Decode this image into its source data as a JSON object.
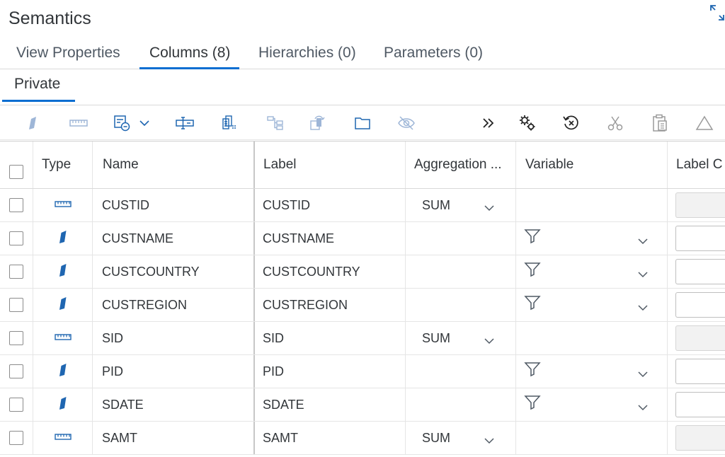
{
  "panel": {
    "title": "Semantics"
  },
  "tabs": [
    {
      "label": "View Properties"
    },
    {
      "label": "Columns (8)"
    },
    {
      "label": "Hierarchies (0)"
    },
    {
      "label": "Parameters (0)"
    }
  ],
  "subtab": {
    "label": "Private"
  },
  "accent_color": "#0a6ed1",
  "icons": {
    "toolbar": [
      "attribute-icon",
      "measure-icon",
      "calculated-column-icon",
      "chevron-down-icon",
      "restricted-column-icon",
      "propagate-icon",
      "hierarchy-icon",
      "assign-semantics-icon",
      "folder-icon",
      "hide-icon",
      "overflow-icon",
      "settings-icon",
      "reset-icon",
      "cut-icon",
      "paste-icon",
      "warning-icon"
    ],
    "expand": "expand-icon"
  },
  "columns": {
    "type": "Type",
    "name": "Name",
    "label": "Label",
    "aggregation": "Aggregation ...",
    "variable": "Variable",
    "label_column": "Label C"
  },
  "rows": [
    {
      "kind": "measure",
      "name": "CUSTID",
      "label": "CUSTID",
      "aggregation": "SUM",
      "filter": false
    },
    {
      "kind": "attribute",
      "name": "CUSTNAME",
      "label": "CUSTNAME",
      "aggregation": "",
      "filter": true
    },
    {
      "kind": "attribute",
      "name": "CUSTCOUNTRY",
      "label": "CUSTCOUNTRY",
      "aggregation": "",
      "filter": true
    },
    {
      "kind": "attribute",
      "name": "CUSTREGION",
      "label": "CUSTREGION",
      "aggregation": "",
      "filter": true
    },
    {
      "kind": "measure",
      "name": "SID",
      "label": "SID",
      "aggregation": "SUM",
      "filter": false
    },
    {
      "kind": "attribute",
      "name": "PID",
      "label": "PID",
      "aggregation": "",
      "filter": true
    },
    {
      "kind": "attribute",
      "name": "SDATE",
      "label": "SDATE",
      "aggregation": "",
      "filter": true
    },
    {
      "kind": "measure",
      "name": "SAMT",
      "label": "SAMT",
      "aggregation": "SUM",
      "filter": false
    }
  ]
}
